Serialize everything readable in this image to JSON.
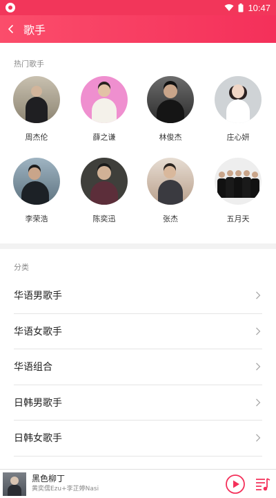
{
  "status_bar": {
    "time": "10:47"
  },
  "header": {
    "title": "歌手"
  },
  "hot": {
    "label": "热门歌手",
    "singers": [
      {
        "name": "周杰伦"
      },
      {
        "name": "薛之谦"
      },
      {
        "name": "林俊杰"
      },
      {
        "name": "庄心妍"
      },
      {
        "name": "李荣浩"
      },
      {
        "name": "陈奕迅"
      },
      {
        "name": "张杰"
      },
      {
        "name": "五月天"
      }
    ]
  },
  "category": {
    "label": "分类",
    "items": [
      {
        "label": "华语男歌手"
      },
      {
        "label": "华语女歌手"
      },
      {
        "label": "华语组合"
      },
      {
        "label": "日韩男歌手"
      },
      {
        "label": "日韩女歌手"
      }
    ]
  },
  "player": {
    "title": "黑色柳丁",
    "artist": "黄奕儒Ezu+李芷婷Nasi"
  },
  "colors": {
    "accent": "#f4305a"
  }
}
